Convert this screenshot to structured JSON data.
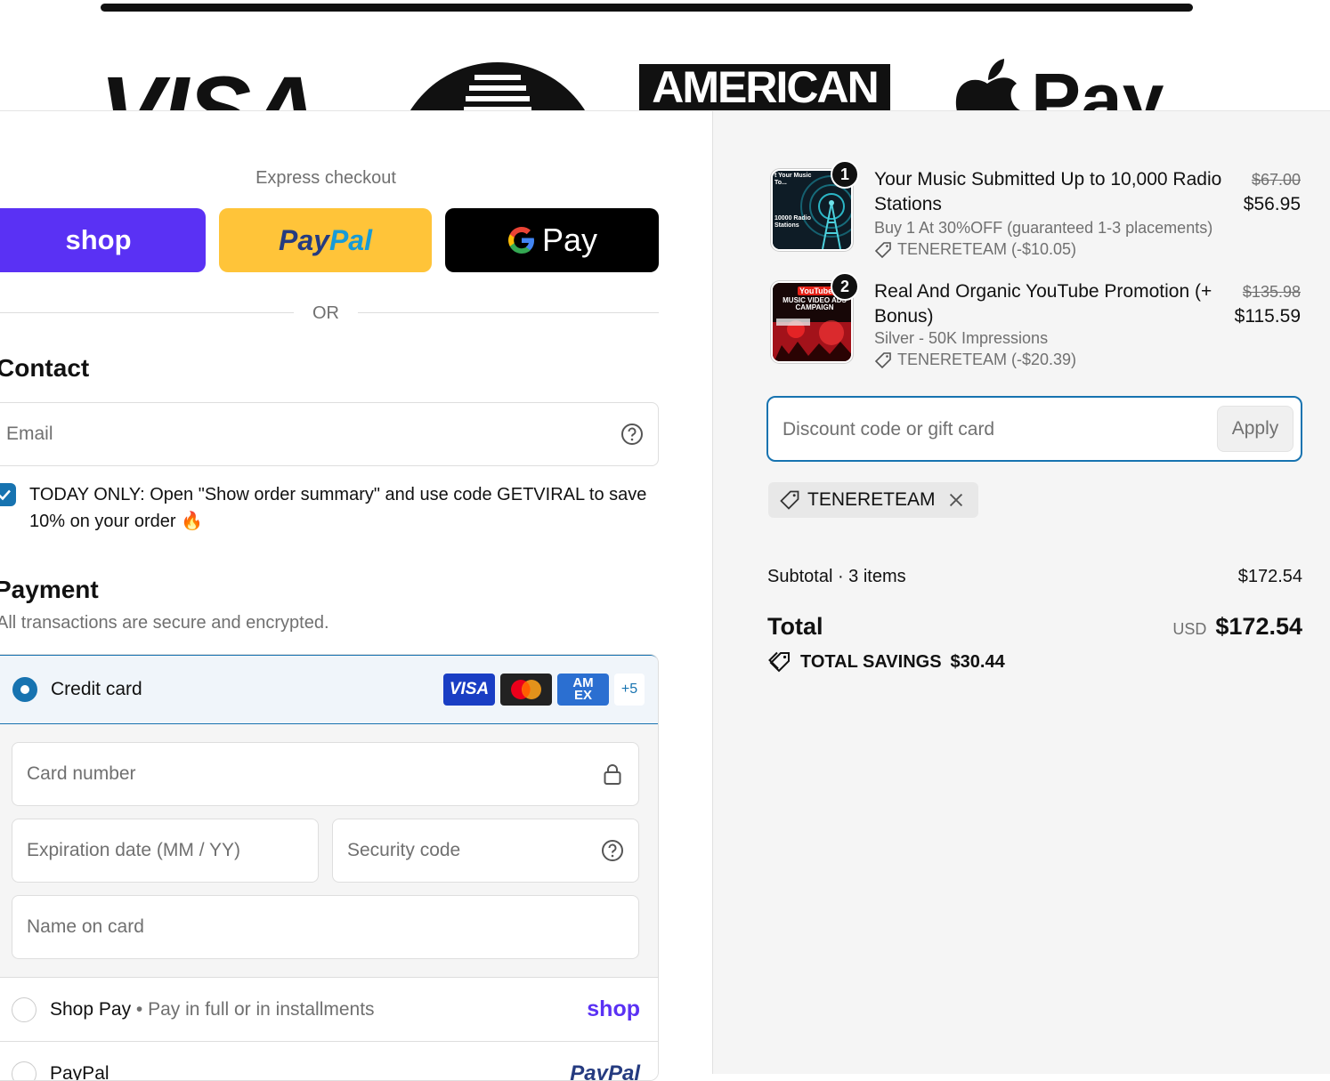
{
  "banner": {
    "visa": "VISA",
    "amex": "AMERICAN",
    "applepay": "Pay"
  },
  "express": {
    "title": "Express checkout",
    "shop_label": "shop",
    "paypal_part1": "Pay",
    "paypal_part2": "Pal",
    "gpay_label": "Pay",
    "or": "OR"
  },
  "contact": {
    "heading": "Contact",
    "email_placeholder": "Email",
    "offer_text": "TODAY ONLY: Open \"Show order summary\" and use code GETVIRAL to save 10% on your order",
    "offer_emoji": "🔥"
  },
  "payment": {
    "heading": "Payment",
    "subheading": "All transactions are secure and encrypted.",
    "credit_card_label": "Credit card",
    "card_brands": {
      "visa": "VISA",
      "amex_top": "AM",
      "amex_bottom": "EX",
      "more": "+5"
    },
    "card_number_placeholder": "Card number",
    "expiry_placeholder": "Expiration date (MM / YY)",
    "security_placeholder": "Security code",
    "name_placeholder": "Name on card",
    "shop_pay_label": "Shop Pay",
    "shop_pay_sub": " • Pay in full or in installments",
    "shop_pay_brand": "shop",
    "paypal_label": "PayPal",
    "paypal_brand": "PayPal"
  },
  "order": {
    "items": [
      {
        "qty": "1",
        "name": "Your Music Submitted Up to 10,000 Radio Stations",
        "variant": "Buy 1 At 30%OFF (guaranteed 1-3 placements)",
        "discount": "TENERETEAM (-$10.05)",
        "old_price": "$67.00",
        "price": "$56.95",
        "thumb_text_top": "t Your Music To...",
        "thumb_text_bottom": "10000 Radio Stations"
      },
      {
        "qty": "2",
        "name": "Real And Organic YouTube Promotion (+ Bonus)",
        "variant": "Silver - 50K Impressions",
        "discount": "TENERETEAM (-$20.39)",
        "old_price": "$135.98",
        "price": "$115.59",
        "thumb_text_top": "YouTube",
        "thumb_text_bottom": "MUSIC VIDEO ADS CAMPAIGN"
      }
    ],
    "discount_placeholder": "Discount code or gift card",
    "apply_label": "Apply",
    "applied_code": "TENERETEAM",
    "subtotal_label": "Subtotal · 3 items",
    "subtotal_value": "$172.54",
    "total_label": "Total",
    "currency": "USD",
    "total_value": "$172.54",
    "savings_label": "TOTAL SAVINGS",
    "savings_value": "$30.44"
  },
  "colors": {
    "accent": "#1773b0",
    "shop_purple": "#5a31f4",
    "paypal_yellow": "#ffc439"
  }
}
